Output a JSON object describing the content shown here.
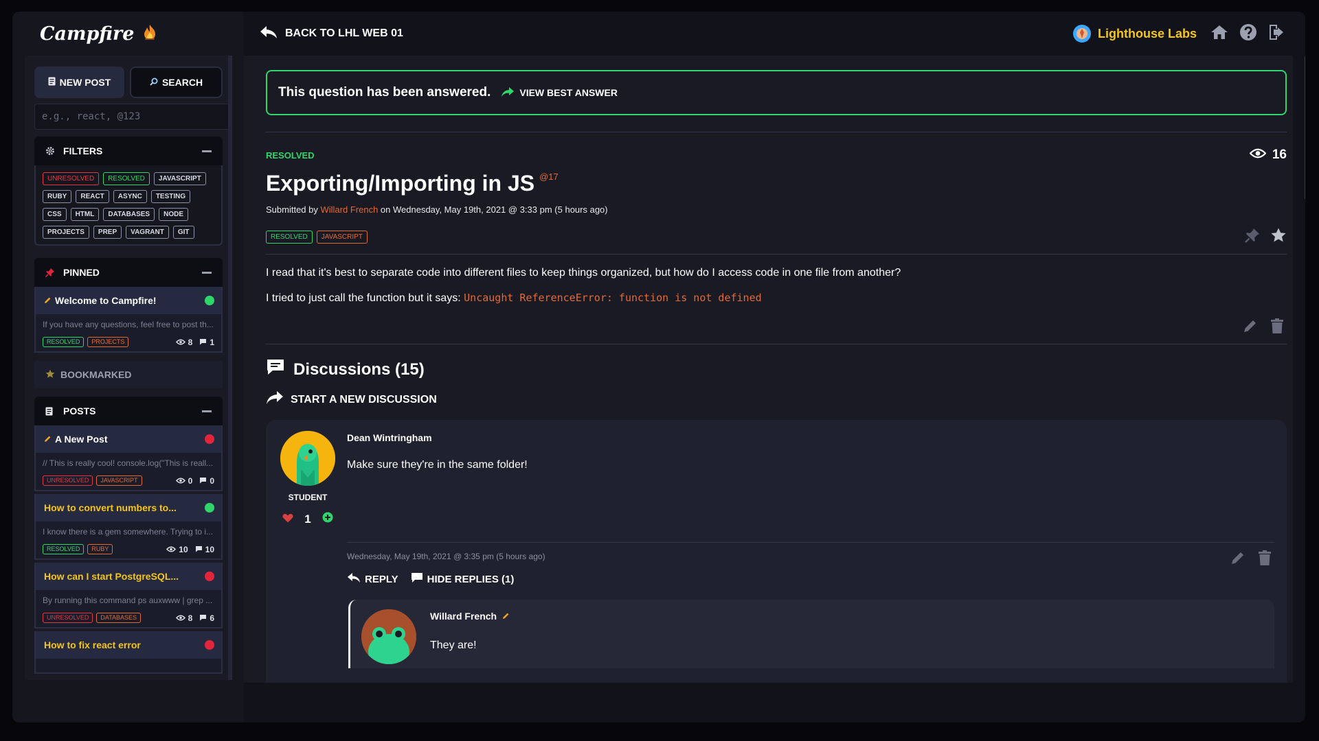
{
  "app": {
    "logo": "Campfire",
    "brand_color": "#f5c518",
    "accent_green": "#2fd66a",
    "accent_red": "#e2243d",
    "accent_orange": "#e36b32"
  },
  "sidebar": {
    "new_post_label": "NEW POST",
    "search_label": "SEARCH",
    "search_placeholder": "e.g., react, @123",
    "filters": {
      "title": "FILTERS",
      "tags": [
        "UNRESOLVED",
        "RESOLVED",
        "JAVASCRIPT",
        "RUBY",
        "REACT",
        "ASYNC",
        "TESTING",
        "CSS",
        "HTML",
        "DATABASES",
        "NODE",
        "PROJECTS",
        "PREP",
        "VAGRANT",
        "GIT"
      ]
    },
    "pinned": {
      "title": "PINNED",
      "items": [
        {
          "title": "Welcome to Campfire!",
          "snippet": "If you have any questions, feel free to post th...",
          "tags": [
            "RESOLVED",
            "PROJECTS"
          ],
          "views": "8",
          "comments": "1"
        }
      ]
    },
    "bookmarked": {
      "title": "BOOKMARKED"
    },
    "posts": {
      "title": "POSTS",
      "items": [
        {
          "title": "A New Post",
          "snippet": "// This is really cool! console.log(\"This is reall...",
          "tags": [
            "UNRESOLVED",
            "JAVASCRIPT"
          ],
          "views": "0",
          "comments": "0"
        },
        {
          "title": "How to convert numbers to...",
          "snippet": "I know there is a gem somewhere. Trying to i...",
          "tags": [
            "RESOLVED",
            "RUBY"
          ],
          "views": "10",
          "comments": "10"
        },
        {
          "title": "How can I start PostgreSQL...",
          "snippet": "By running this command ps auxwww | grep ...",
          "tags": [
            "UNRESOLVED",
            "DATABASES"
          ],
          "views": "8",
          "comments": "6"
        },
        {
          "title": "How to fix react error"
        }
      ]
    }
  },
  "topbar": {
    "back_label": "BACK TO LHL WEB 01",
    "org_name": "Lighthouse Labs"
  },
  "post": {
    "answered_text": "This question has been answered.",
    "best_answer_label": "VIEW BEST ANSWER",
    "status": "RESOLVED",
    "views": "16",
    "title": "Exporting/Importing in JS",
    "id": "@17",
    "submitted_prefix": "Submitted by",
    "author": "Willard French",
    "submitted_suffix": "on Wednesday, May 19th, 2021 @ 3:33 pm (5 hours ago)",
    "tags": [
      "RESOLVED",
      "JAVASCRIPT"
    ],
    "body_1": "I read that it's best to separate code into different files to keep things organized, but how do I access code in one file from another?",
    "body_2_prefix": "I tried to just call the function but it says:",
    "body_2_code": "Uncaught ReferenceError: function is not defined"
  },
  "discussions": {
    "title": "Discussions (15)",
    "start_label": "START A NEW DISCUSSION",
    "comment": {
      "author": "Dean Wintringham",
      "role": "STUDENT",
      "votes": "1",
      "text": "Make sure they're in the same folder!",
      "time": "Wednesday, May 19th, 2021 @ 3:35 pm (5 hours ago)",
      "reply_label": "REPLY",
      "hide_replies_label": "HIDE REPLIES (1)"
    },
    "reply": {
      "author": "Willard French",
      "text": "They are!"
    }
  }
}
